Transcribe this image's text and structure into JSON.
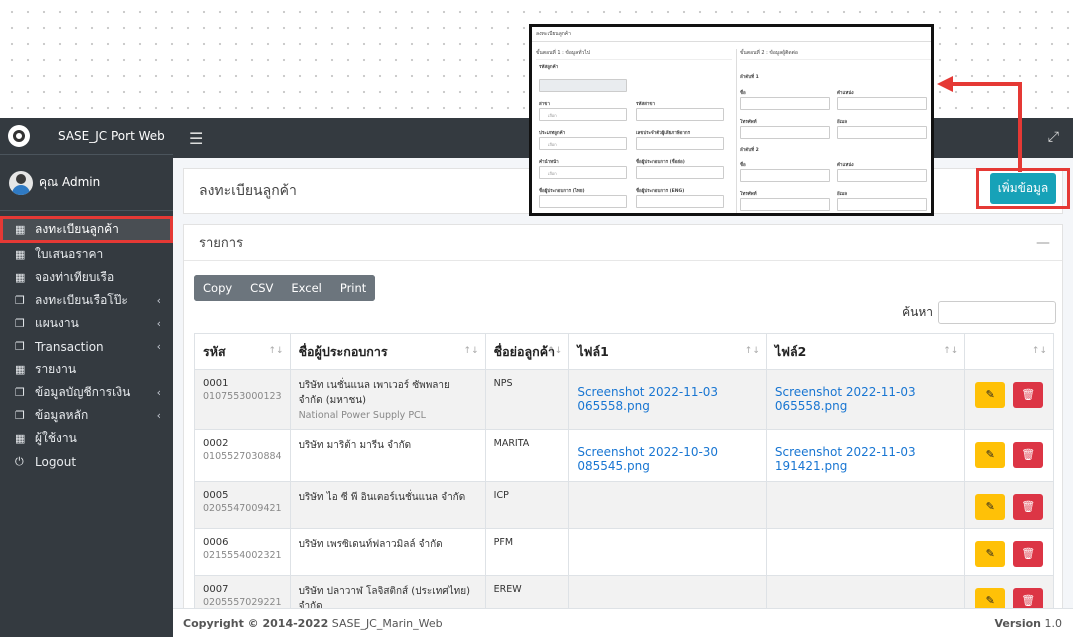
{
  "sidebar": {
    "brand": "SASE_JC Port Web",
    "user": "คุณ Admin",
    "items": [
      {
        "label": "ลงทะเบียนลูกค้า",
        "icon": "grid-icon"
      },
      {
        "label": "ใบเสนอราคา",
        "icon": "grid-icon"
      },
      {
        "label": "จองท่าเทียบเรือ",
        "icon": "grid-icon"
      },
      {
        "label": "ลงทะเบียนเรือโป๊ะ",
        "icon": "copy-icon"
      },
      {
        "label": "แผนงาน",
        "icon": "copy-icon"
      },
      {
        "label": "Transaction",
        "icon": "copy-icon"
      },
      {
        "label": "รายงาน",
        "icon": "grid-icon"
      },
      {
        "label": "ข้อมูลบัญชีการเงิน",
        "icon": "copy-icon"
      },
      {
        "label": "ข้อมูลหลัก",
        "icon": "copy-icon"
      },
      {
        "label": "ผู้ใช้งาน",
        "icon": "grid-icon"
      },
      {
        "label": "Logout",
        "icon": "power-icon"
      }
    ]
  },
  "page": {
    "title": "ลงทะเบียนลูกค้า",
    "add_button": "เพิ่มข้อมูล",
    "list_title": "รายการ",
    "search_label": "ค้นหา"
  },
  "toolbar": {
    "copy": "Copy",
    "csv": "CSV",
    "excel": "Excel",
    "print": "Print"
  },
  "table": {
    "headers": [
      "รหัส",
      "ชื่อผู้ประกอบการ",
      "ชื่อย่อลูกค้า",
      "ไฟล์1",
      "ไฟล์2"
    ],
    "rows": [
      {
        "code": "0001",
        "taxid": "0107553000123",
        "name": "บริษัท เนชั่นแนล เพาเวอร์ ซัพพลาย จำกัด (มหาชน)",
        "name_en": "National Power Supply PCL",
        "abbr": "NPS",
        "file1": "Screenshot 2022-11-03 065558.png",
        "file2": "Screenshot 2022-11-03 065558.png"
      },
      {
        "code": "0002",
        "taxid": "0105527030884",
        "name": "บริษัท มาริต้า มารีน จำกัด",
        "name_en": "",
        "abbr": "MARITA",
        "file1": "Screenshot 2022-10-30 085545.png",
        "file2": "Screenshot 2022-11-03 191421.png"
      },
      {
        "code": "0005",
        "taxid": "0205547009421",
        "name": "บริษัท ไอ ซี พี อินเตอร์เนชั่นแนล จำกัด",
        "name_en": "",
        "abbr": "ICP",
        "file1": "",
        "file2": ""
      },
      {
        "code": "0006",
        "taxid": "0215554002321",
        "name": "บริษัท เพรซิเดนท์ฟลาวมิลล์ จำกัด",
        "name_en": "",
        "abbr": "PFM",
        "file1": "",
        "file2": ""
      },
      {
        "code": "0007",
        "taxid": "0205557029221",
        "name": "บริษัท ปลาวาฬ โลจิสติกส์ (ประเทศไทย) จำกัด",
        "name_en": "",
        "abbr": "EREW",
        "file1": "",
        "file2": ""
      }
    ]
  },
  "footer": {
    "copyright_prefix": "Copyright © 2014-2022",
    "company": "SASE_JC_Marin_Web",
    "version_label": "Version",
    "version": "1.0"
  },
  "overlay": {
    "title": "ลงทะเบียนลูกค้า",
    "step1": "ขั้นตอนที่ 1 : ข้อมูลทั่วไป",
    "step2": "ขั้นตอนที่ 2 : ข้อมูลผู้ติดต่อ",
    "customer_code": "รหัสลูกค้า",
    "branch": "สาขา",
    "branch_code": "รหัสสาขา",
    "customer_type": "ประเภทลูกค้า",
    "tax_id": "เลขประจำตัวผู้เสียภาษีอากร",
    "prefix": "คำนำหน้า",
    "name_short": "ชื่อผู้ประกอบการ (ชื่อย่อ)",
    "name_th": "ชื่อผู้ประกอบการ (ไทย)",
    "name_en": "ชื่อผู้ประกอบการ (ENG)",
    "select": "เลือก",
    "contact1": "ลำดับที่ 1",
    "contact2": "ลำดับที่ 2",
    "c_name": "ชื่อ",
    "c_position": "ตำแหน่ง",
    "c_phone": "โทรศัพท์",
    "c_email": "อีเมล"
  },
  "colors": {
    "accent": "#17a2b8",
    "highlight": "#e53935",
    "sidebar": "#343a40"
  }
}
